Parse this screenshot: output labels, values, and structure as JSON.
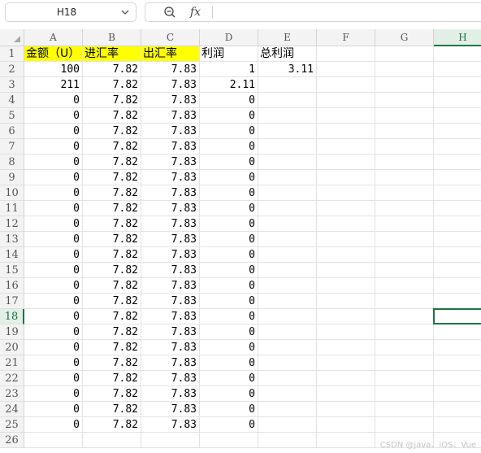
{
  "namebox": {
    "value": "H18"
  },
  "formula_bar": {
    "fx_label": "fx",
    "value": ""
  },
  "columns": [
    "A",
    "B",
    "C",
    "D",
    "E",
    "F",
    "G",
    "H"
  ],
  "selected_column": "H",
  "selected_row": "18",
  "headers_row": [
    "金额（U）",
    "进汇率",
    "出汇率",
    "利润",
    "总利润"
  ],
  "rows": [
    {
      "n": "2",
      "a": "100",
      "b": "7.82",
      "c": "7.83",
      "d": "1",
      "e": "3.11"
    },
    {
      "n": "3",
      "a": "211",
      "b": "7.82",
      "c": "7.83",
      "d": "2.11",
      "e": ""
    },
    {
      "n": "4",
      "a": "0",
      "b": "7.82",
      "c": "7.83",
      "d": "0",
      "e": ""
    },
    {
      "n": "5",
      "a": "0",
      "b": "7.82",
      "c": "7.83",
      "d": "0",
      "e": ""
    },
    {
      "n": "6",
      "a": "0",
      "b": "7.82",
      "c": "7.83",
      "d": "0",
      "e": ""
    },
    {
      "n": "7",
      "a": "0",
      "b": "7.82",
      "c": "7.83",
      "d": "0",
      "e": ""
    },
    {
      "n": "8",
      "a": "0",
      "b": "7.82",
      "c": "7.83",
      "d": "0",
      "e": ""
    },
    {
      "n": "9",
      "a": "0",
      "b": "7.82",
      "c": "7.83",
      "d": "0",
      "e": ""
    },
    {
      "n": "10",
      "a": "0",
      "b": "7.82",
      "c": "7.83",
      "d": "0",
      "e": ""
    },
    {
      "n": "11",
      "a": "0",
      "b": "7.82",
      "c": "7.83",
      "d": "0",
      "e": ""
    },
    {
      "n": "12",
      "a": "0",
      "b": "7.82",
      "c": "7.83",
      "d": "0",
      "e": ""
    },
    {
      "n": "13",
      "a": "0",
      "b": "7.82",
      "c": "7.83",
      "d": "0",
      "e": ""
    },
    {
      "n": "14",
      "a": "0",
      "b": "7.82",
      "c": "7.83",
      "d": "0",
      "e": ""
    },
    {
      "n": "15",
      "a": "0",
      "b": "7.82",
      "c": "7.83",
      "d": "0",
      "e": ""
    },
    {
      "n": "16",
      "a": "0",
      "b": "7.82",
      "c": "7.83",
      "d": "0",
      "e": ""
    },
    {
      "n": "17",
      "a": "0",
      "b": "7.82",
      "c": "7.83",
      "d": "0",
      "e": ""
    },
    {
      "n": "18",
      "a": "0",
      "b": "7.82",
      "c": "7.83",
      "d": "0",
      "e": ""
    },
    {
      "n": "19",
      "a": "0",
      "b": "7.82",
      "c": "7.83",
      "d": "0",
      "e": ""
    },
    {
      "n": "20",
      "a": "0",
      "b": "7.82",
      "c": "7.83",
      "d": "0",
      "e": ""
    },
    {
      "n": "21",
      "a": "0",
      "b": "7.82",
      "c": "7.83",
      "d": "0",
      "e": ""
    },
    {
      "n": "22",
      "a": "0",
      "b": "7.82",
      "c": "7.83",
      "d": "0",
      "e": ""
    },
    {
      "n": "23",
      "a": "0",
      "b": "7.82",
      "c": "7.83",
      "d": "0",
      "e": ""
    },
    {
      "n": "24",
      "a": "0",
      "b": "7.82",
      "c": "7.83",
      "d": "0",
      "e": ""
    },
    {
      "n": "25",
      "a": "0",
      "b": "7.82",
      "c": "7.83",
      "d": "0",
      "e": ""
    },
    {
      "n": "26",
      "a": "",
      "b": "",
      "c": "",
      "d": "",
      "e": ""
    }
  ],
  "colors": {
    "header_highlight": "#ffff00",
    "selection": "#217346"
  },
  "watermark": "CSDN @java、iOS、Vue"
}
